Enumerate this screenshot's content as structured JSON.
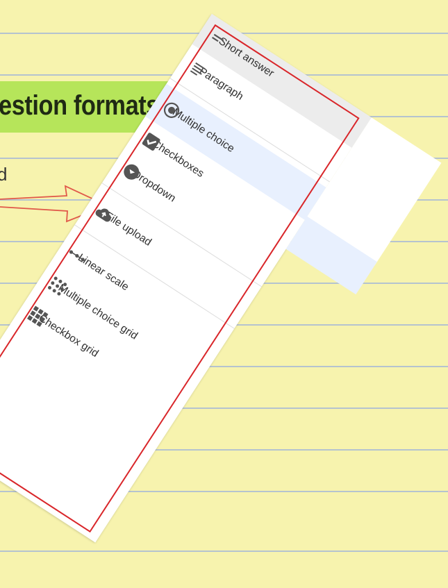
{
  "slide": {
    "heading": "estion formats:",
    "cut_text": "d"
  },
  "menu": {
    "items": [
      {
        "label": "Short answer",
        "icon": "short-answer-icon"
      },
      {
        "label": "Paragraph",
        "icon": "paragraph-icon"
      },
      {
        "label": "Multiple choice",
        "icon": "radio-button-icon"
      },
      {
        "label": "Checkboxes",
        "icon": "checkbox-icon"
      },
      {
        "label": "Dropdown",
        "icon": "dropdown-icon"
      },
      {
        "label": "File upload",
        "icon": "cloud-upload-icon"
      },
      {
        "label": "Linear scale",
        "icon": "linear-scale-icon"
      },
      {
        "label": "Multiple choice grid",
        "icon": "dots-grid-icon"
      },
      {
        "label": "Checkbox grid",
        "icon": "checkbox-grid-icon"
      }
    ],
    "selected_item": "Multiple choice"
  },
  "colors": {
    "paper": "#f7f3ae",
    "highlight": "#b6e55a",
    "annotation_red": "#d9262a",
    "selected_row": "#e8f0fe"
  }
}
